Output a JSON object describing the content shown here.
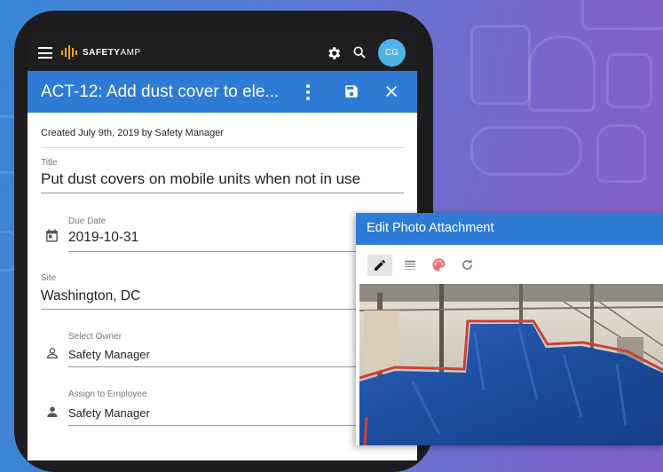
{
  "app": {
    "brand": {
      "bold": "SAFETY",
      "light": "AMP"
    },
    "avatar_initials": "CG"
  },
  "action": {
    "title": "ACT-12: Add dust cover to ele...",
    "created_text": "Created July 9th, 2019 by Safety Manager",
    "fields": {
      "title": {
        "label": "Title",
        "value": "Put dust covers on mobile units when not in use"
      },
      "due_date": {
        "label": "Due Date",
        "value": "2019-10-31"
      },
      "site": {
        "label": "Site",
        "value": "Washington, DC"
      },
      "owner": {
        "label": "Select Owner",
        "value": "Safety Manager"
      },
      "employee": {
        "label": "Assign to Employee",
        "value": "Safety Manager"
      }
    }
  },
  "photo_editor": {
    "title": "Edit Photo Attachment",
    "tools": [
      "pencil-icon",
      "line-weight-icon",
      "palette-icon",
      "redo-icon"
    ],
    "active_tool": "pencil-icon"
  },
  "colors": {
    "primary": "#2e7bd6",
    "topbar": "#1f1f21",
    "avatar": "#4fb3e8",
    "logo_accent": "#f5a623",
    "annotation_stroke": "#c8423a",
    "palette_tool": "#e57373"
  }
}
